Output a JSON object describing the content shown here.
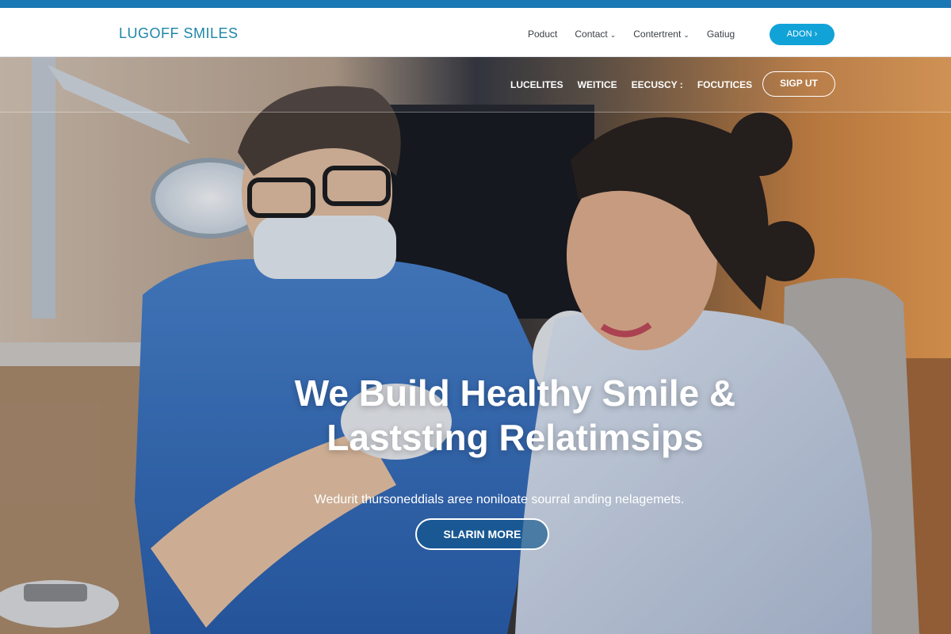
{
  "header": {
    "logo": "LUGOFF SMILES",
    "nav": [
      {
        "label": "Poduct",
        "has_dropdown": false
      },
      {
        "label": "Contact",
        "has_dropdown": true
      },
      {
        "label": "Contertrent",
        "has_dropdown": true
      },
      {
        "label": "Gatiug",
        "has_dropdown": false
      }
    ],
    "cta_label": "ADON ›"
  },
  "hero": {
    "nav": [
      "LUCELITES",
      "WEITICE",
      "EECUSCY :",
      "FOCUTICES"
    ],
    "signup_label": "SIGP UT",
    "headline_line1": "We Build Healthy Smile &",
    "headline_line2": "Laststing Relatimsips",
    "subtext": "Wedurit thursoneddials aree noniloate sourral anding nelagemets.",
    "button_label": "SLARIN MORE"
  },
  "colors": {
    "brand_blue": "#1a78b4",
    "cta_blue": "#11a3d8",
    "logo_teal": "#1e86a8"
  }
}
